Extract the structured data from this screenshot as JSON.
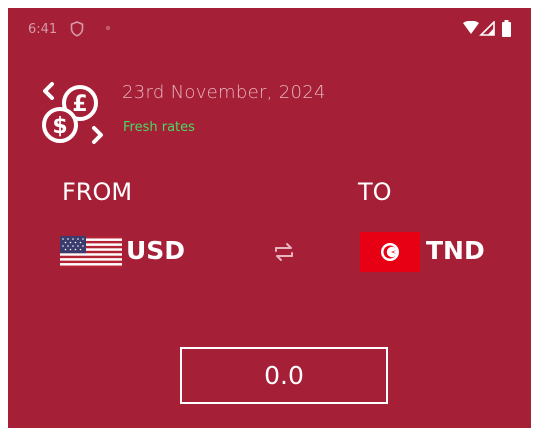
{
  "status_bar": {
    "time": "6:41",
    "icons": [
      "shield-icon",
      "dot-icon",
      "wifi-icon",
      "signal-icon",
      "battery-icon"
    ]
  },
  "header": {
    "icon": "currency-exchange-icon",
    "date": "23rd November, 2024",
    "rates_status": "Fresh rates"
  },
  "conversion": {
    "from_label": "FROM",
    "to_label": "TO",
    "from_currency": {
      "code": "USD",
      "flag": "us-flag-icon"
    },
    "to_currency": {
      "code": "TND",
      "flag": "tn-flag-icon"
    },
    "swap_icon": "swap-icon",
    "amount": "0.0"
  },
  "colors": {
    "background": "#a51f36",
    "fresh_rates": "#4cd964",
    "text": "#ffffff",
    "tn_flag_red": "#e70013"
  }
}
